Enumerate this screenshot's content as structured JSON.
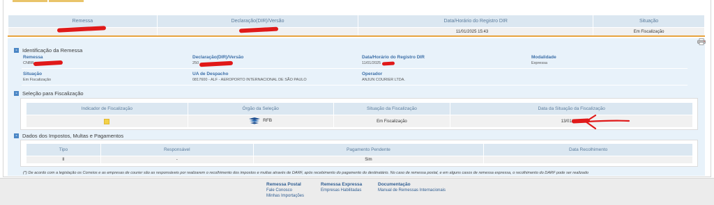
{
  "colors": {
    "header_bg": "#dbe7f1",
    "header_text": "#5b7c9c",
    "label_blue": "#3c6fa8",
    "detail_bg": "#e8f2fa",
    "accent_orange": "#e8a33d",
    "indicator_yellow": "#f3d148",
    "annotation_red": "#e01919",
    "link_blue": "#2f5d92"
  },
  "summary": {
    "headers": [
      "Remessa",
      "Declaração(DIR)/Versão",
      "Data/Horário do Registro DIR",
      "Situação"
    ],
    "row": [
      "",
      "",
      "11/01/2025 15:43",
      "Em Fiscalização"
    ]
  },
  "identificacao": {
    "title": "Identificação da Remessa",
    "remessa_label": "Remessa",
    "remessa_value": "CNBR",
    "declaracao_label": "Declaração(DIR)/Versão",
    "declaracao_value": "250",
    "data_label": "Data/Horário do Registro DIR",
    "data_value": "11/01/2025",
    "modalidade_label": "Modalidade",
    "modalidade_value": "Expressa",
    "situacao_label": "Situação",
    "situacao_value": "Em Fiscalização",
    "ua_label": "UA de Despacho",
    "ua_value": "0817600 - ALF - AEROPORTO INTERNACIONAL DE SÃO PAULO",
    "operador_label": "Operador",
    "operador_value": "ANJUN COURIER LTDA."
  },
  "selecao": {
    "title": "Seleção para Fiscalização",
    "headers": [
      "Indicador de Fiscalização",
      "Órgão da Seleção",
      "Situação da Fiscalização",
      "Data da Situação da Fiscalização"
    ],
    "orgao": "RFB",
    "situacao": "Em Fiscalização",
    "data": "13/01/2025"
  },
  "impostos": {
    "title": "Dados dos Impostos, Multas e Pagamentos",
    "headers": [
      "Tipo",
      "Responsável",
      "Pagamento Pendente",
      "Data Recolhimento"
    ],
    "row": [
      "II",
      "-",
      "Sim",
      ""
    ]
  },
  "note": "(*) De acordo com a legislação os Correios e as empresas de courier são as responsáveis por realizarem o recolhimento dos impostos e multas através de DARF, após recebimento do pagamento do destinatário. No caso de remessa postal, e em alguns casos de remessa expressa, o recolhimento do DARF pode ser realizado",
  "footer": {
    "col1": {
      "title": "Remessa Postal",
      "links": [
        "Fale Conosco",
        "Minhas Importações"
      ]
    },
    "col2": {
      "title": "Remessa Expressa",
      "links": [
        "Empresas Habilitadas"
      ]
    },
    "col3": {
      "title": "Documentação",
      "links": [
        "Manual de Remessas Internacionais"
      ]
    }
  },
  "icons": [
    "printer-icon",
    "collapse-icon",
    "rfb-logo-icon",
    "indicator-square-icon"
  ]
}
